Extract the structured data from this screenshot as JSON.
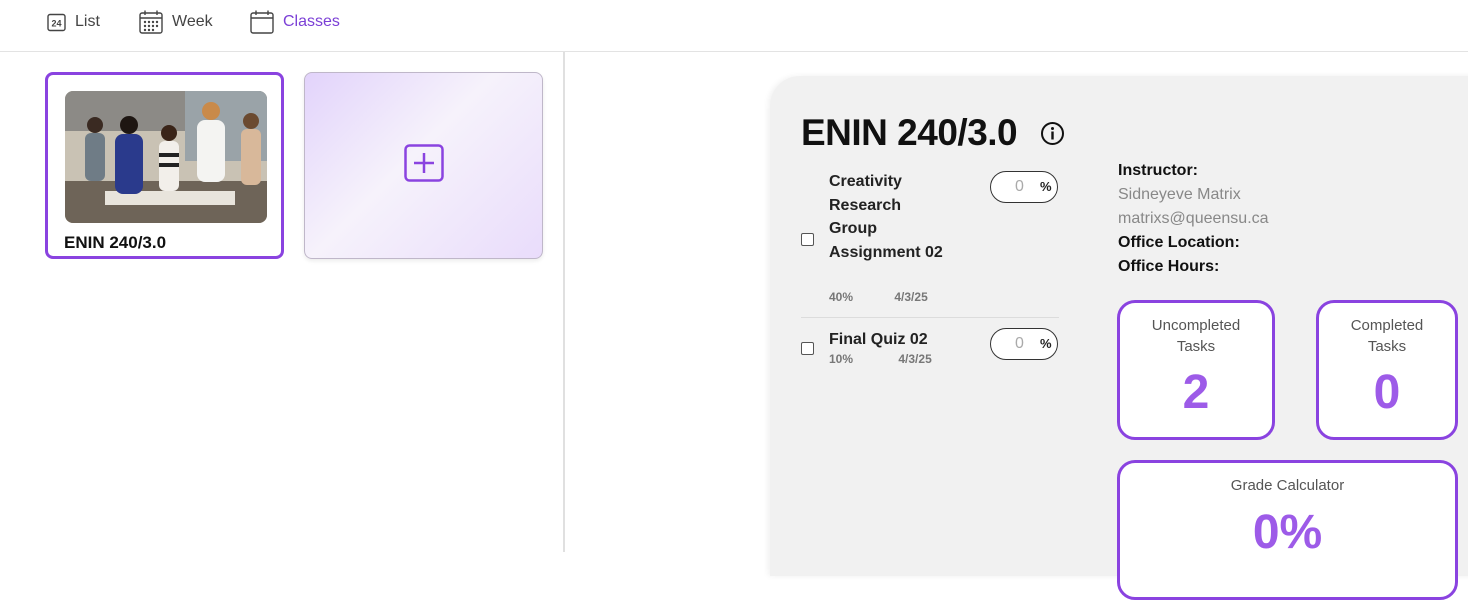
{
  "nav": {
    "list_icon_text": "24",
    "list_label": "List",
    "week_label": "Week",
    "classes_label": "Classes"
  },
  "class_card": {
    "title": "ENIN 240/3.0"
  },
  "detail": {
    "course_title": "ENIN 240/3.0",
    "tasks": [
      {
        "name": "Creativity Research Group Assignment 02",
        "weight": "40%",
        "date": "4/3/25",
        "grade": "0",
        "unit": "%"
      },
      {
        "name": "Final Quiz 02",
        "weight": "10%",
        "date": "4/3/25",
        "grade": "0",
        "unit": "%"
      }
    ],
    "instructor": {
      "instructor_label": "Instructor:",
      "name": "Sidneyeve Matrix",
      "email": "matrixs@queensu.ca",
      "office_location_label": "Office Location:",
      "office_hours_label": "Office Hours:"
    },
    "stats": {
      "uncompleted_label_1": "Uncompleted",
      "uncompleted_label_2": "Tasks",
      "uncompleted_value": "2",
      "completed_label_1": "Completed",
      "completed_label_2": "Tasks",
      "completed_value": "0",
      "grade_calc_label": "Grade Calculator",
      "grade_calc_value": "0%"
    }
  },
  "colors": {
    "accent": "#8a43e0",
    "accent_text": "#7b3fd6",
    "stat_value": "#9d5be8",
    "panel_bg": "#f1f1f1"
  },
  "icons": {
    "list": "calendar-day-icon",
    "week": "calendar-grid-icon",
    "classes": "calendar-icon",
    "add": "plus-square-icon",
    "info": "info-circle-icon"
  }
}
